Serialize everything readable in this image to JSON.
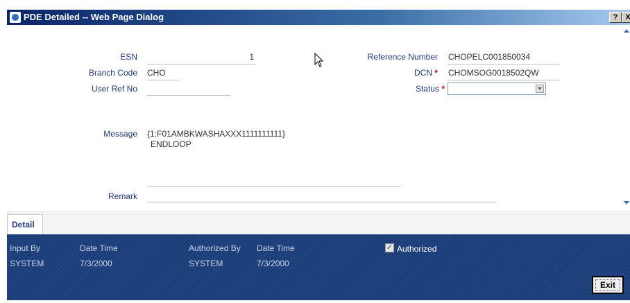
{
  "window": {
    "title": "PDE Detailed -- Web Page Dialog",
    "help_label": "?",
    "close_label": "X"
  },
  "form": {
    "esn": {
      "label": "ESN",
      "value": "1"
    },
    "branch_code": {
      "label": "Branch Code",
      "value": "CHO"
    },
    "user_ref_no": {
      "label": "User Ref No",
      "value": ""
    },
    "reference_number": {
      "label": "Reference Number",
      "value": "CHOPELC001850034"
    },
    "dcn": {
      "label": "DCN",
      "required_mark": "*",
      "value": "CHOMSOG0018502QW"
    },
    "status": {
      "label": "Status",
      "required_mark": "*",
      "value": ""
    },
    "message": {
      "label": "Message",
      "line1": "{1:F01AMBKWASHAXXX1111111111}",
      "line2": "ENDLOOP"
    },
    "remark": {
      "label": "Remark",
      "value": ""
    }
  },
  "tabs": {
    "detail": "Detail"
  },
  "footer": {
    "input_by_label": "Input By",
    "date_time_label_1": "Date Time",
    "authorized_by_label": "Authorized By",
    "date_time_label_2": "Date Time",
    "authorized_label": "Authorized",
    "authorized_checked": true,
    "input_by_value": "SYSTEM",
    "date_time_value_1": "7/3/2000",
    "authorized_by_value": "SYSTEM",
    "date_time_value_2": "7/3/2000",
    "exit_label": "Exit"
  },
  "colors": {
    "title_bar": "#0a246a",
    "footer_bg": "#1b3e7a",
    "label_text": "#1f3a78",
    "required": "#cc0000"
  },
  "icons": [
    "window-app-icon",
    "help-icon",
    "close-icon",
    "scroll-up-icon",
    "scroll-down-icon",
    "mouse-cursor-icon",
    "dropdown-arrow-icon"
  ]
}
